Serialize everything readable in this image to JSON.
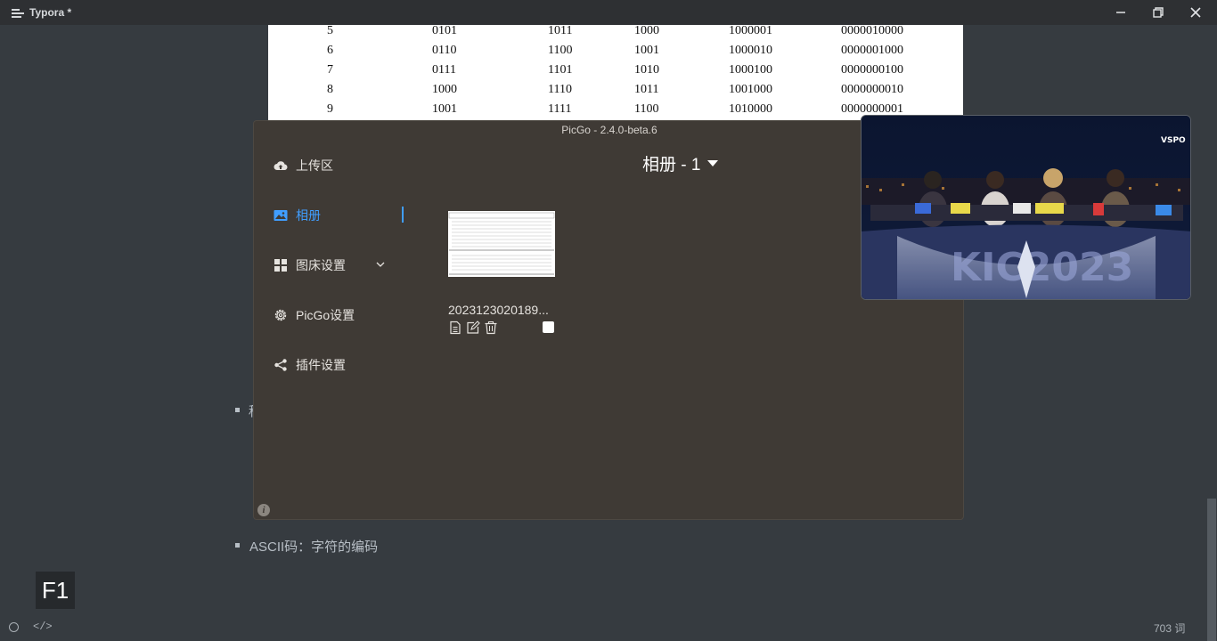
{
  "titlebar": {
    "title": "Typora *"
  },
  "doc_table": {
    "rows": [
      [
        "5",
        "0101",
        "1011",
        "1000",
        "1000001",
        "0000010000"
      ],
      [
        "6",
        "0110",
        "1100",
        "1001",
        "1000010",
        "0000001000"
      ],
      [
        "7",
        "0111",
        "1101",
        "1010",
        "1000100",
        "0000000100"
      ],
      [
        "8",
        "1000",
        "1110",
        "1011",
        "1001000",
        "0000000010"
      ],
      [
        "9",
        "1001",
        "1111",
        "1100",
        "1010000",
        "0000000001"
      ]
    ]
  },
  "document": {
    "partial_bullet_char": "种",
    "ascii_bullet": "ASCII码：字符的编码"
  },
  "picgo": {
    "title": "PicGo - 2.4.0-beta.6",
    "nav": [
      {
        "label": "上传区",
        "icon": "cloud-upload-icon"
      },
      {
        "label": "相册",
        "icon": "image-icon"
      },
      {
        "label": "图床设置",
        "icon": "grid-icon"
      },
      {
        "label": "PicGo设置",
        "icon": "gear-icon"
      },
      {
        "label": "插件设置",
        "icon": "share-icon"
      }
    ],
    "album_title": "相册 - 1",
    "image_name": "2023123020189..."
  },
  "keyhint": "F1",
  "statusbar": {
    "code_toggle": "</>",
    "word_count": "703 词"
  },
  "colors": {
    "accent": "#409eff",
    "picgo_bg": "#3f3a35",
    "editor_bg": "#363b40"
  }
}
